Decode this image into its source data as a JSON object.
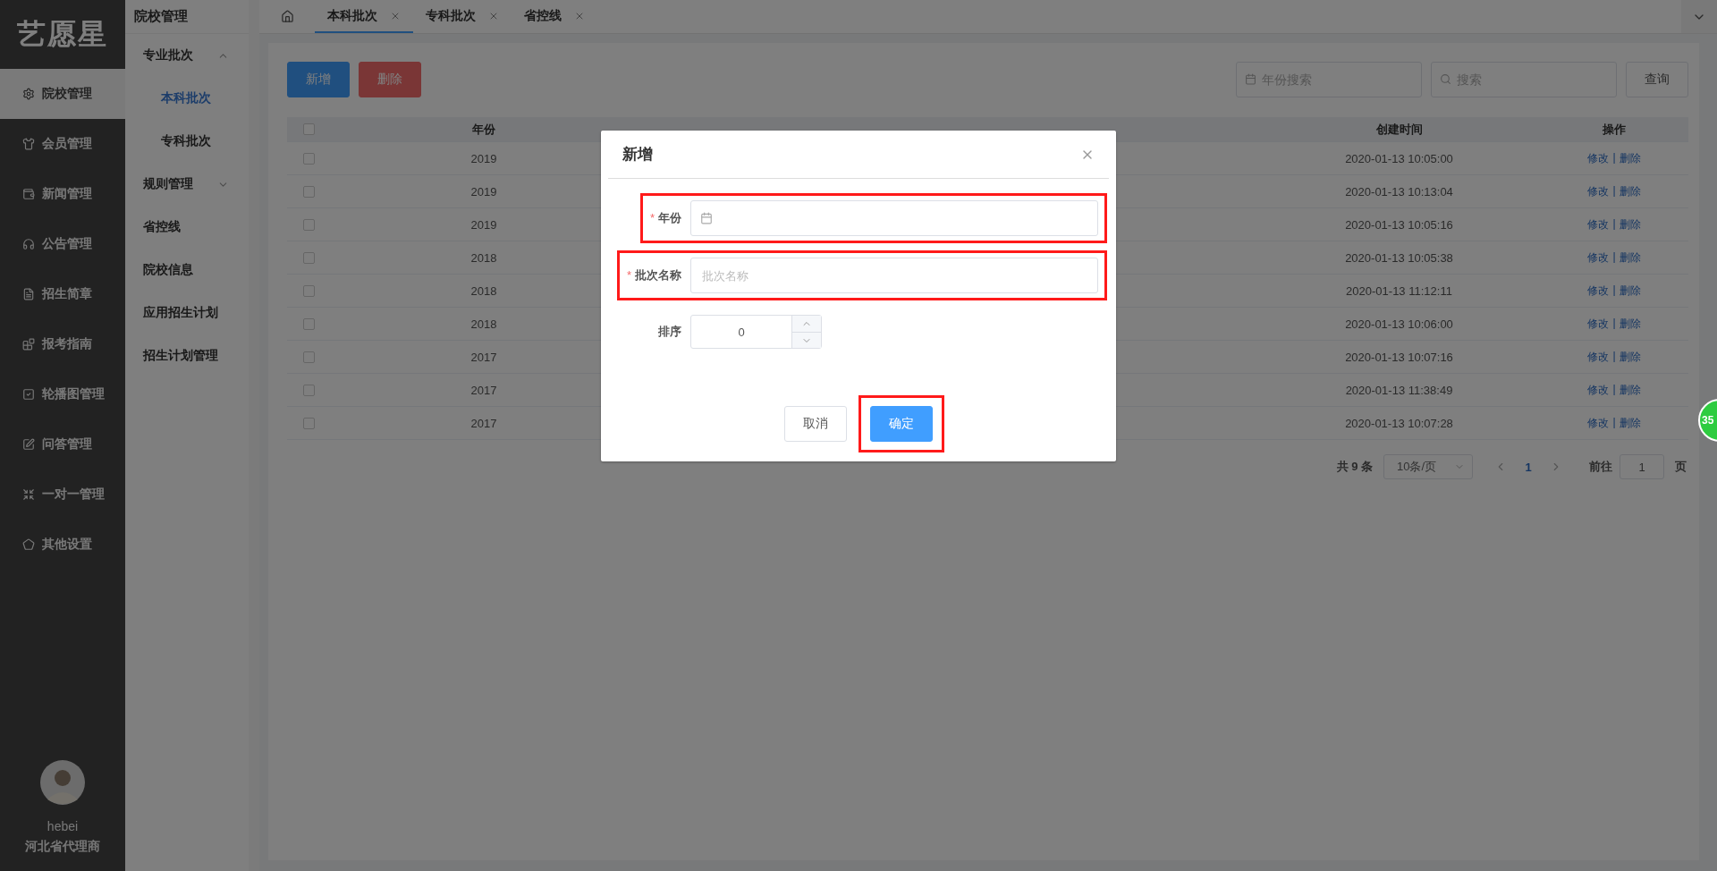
{
  "logo": "艺愿星",
  "nav": [
    {
      "label": "院校管理",
      "selected": true
    },
    {
      "label": "会员管理",
      "selected": false
    },
    {
      "label": "新闻管理",
      "selected": false
    },
    {
      "label": "公告管理",
      "selected": false
    },
    {
      "label": "招生简章",
      "selected": false
    },
    {
      "label": "报考指南",
      "selected": false
    },
    {
      "label": "轮播图管理",
      "selected": false
    },
    {
      "label": "问答管理",
      "selected": false
    },
    {
      "label": "一对一管理",
      "selected": false
    },
    {
      "label": "其他设置",
      "selected": false
    }
  ],
  "user": {
    "name": "hebei",
    "role": "河北省代理商"
  },
  "subnav": {
    "title": "院校管理",
    "items": [
      {
        "label": "专业批次",
        "kind": "group",
        "expanded": true,
        "selected": false,
        "children": [
          {
            "label": "本科批次",
            "selected": true
          },
          {
            "label": "专科批次",
            "selected": false
          }
        ]
      },
      {
        "label": "规则管理",
        "kind": "group",
        "expanded": false,
        "selected": false
      },
      {
        "label": "省控线",
        "kind": "link",
        "selected": false
      },
      {
        "label": "院校信息",
        "kind": "link",
        "selected": false
      },
      {
        "label": "应用招生计划",
        "kind": "link",
        "selected": false
      },
      {
        "label": "招生计划管理",
        "kind": "link",
        "selected": false
      }
    ]
  },
  "tabs": [
    {
      "label": "本科批次",
      "selected": true
    },
    {
      "label": "专科批次",
      "selected": false
    },
    {
      "label": "省控线",
      "selected": false
    }
  ],
  "toolbar": {
    "buttons": [
      {
        "label": "新增",
        "kind": "primary"
      },
      {
        "label": "删除",
        "kind": "danger"
      }
    ],
    "year_search": {
      "placeholder": "年份搜索"
    },
    "search": {
      "placeholder": "搜索"
    },
    "query_button": "查询"
  },
  "table": {
    "all_checked": false,
    "columns": [
      "年份",
      "创建时间",
      "操作"
    ],
    "action_separator": "|",
    "rows": [
      {
        "checked": false,
        "year": "2019",
        "created": "2020-01-13 10:05:00",
        "actions": [
          "修改",
          "删除"
        ]
      },
      {
        "checked": false,
        "year": "2019",
        "created": "2020-01-13 10:13:04",
        "actions": [
          "修改",
          "删除"
        ]
      },
      {
        "checked": false,
        "year": "2019",
        "created": "2020-01-13 10:05:16",
        "actions": [
          "修改",
          "删除"
        ]
      },
      {
        "checked": false,
        "year": "2018",
        "created": "2020-01-13 10:05:38",
        "actions": [
          "修改",
          "删除"
        ]
      },
      {
        "checked": false,
        "year": "2018",
        "created": "2020-01-13 11:12:11",
        "actions": [
          "修改",
          "删除"
        ]
      },
      {
        "checked": false,
        "year": "2018",
        "created": "2020-01-13 10:06:00",
        "actions": [
          "修改",
          "删除"
        ]
      },
      {
        "checked": false,
        "year": "2017",
        "created": "2020-01-13 10:07:16",
        "actions": [
          "修改",
          "删除"
        ]
      },
      {
        "checked": false,
        "year": "2017",
        "created": "2020-01-13 11:38:49",
        "actions": [
          "修改",
          "删除"
        ]
      },
      {
        "checked": false,
        "year": "2017",
        "created": "2020-01-13 10:07:28",
        "actions": [
          "修改",
          "删除"
        ]
      }
    ]
  },
  "pagination": {
    "total": "共 9 条",
    "page_size": "10条/页",
    "pages": [
      {
        "label": "1",
        "selected": true
      }
    ],
    "goto_label": "前往",
    "goto_value": "1",
    "page_suffix": "页"
  },
  "dialog": {
    "title": "新增",
    "fields": [
      {
        "kind": "date",
        "label": "年份",
        "required_mark": "*",
        "highlighted": true
      },
      {
        "kind": "text",
        "label": "批次名称",
        "placeholder": "批次名称",
        "required_mark": "*",
        "highlighted": true
      },
      {
        "kind": "number",
        "label": "排序",
        "value": "0",
        "highlighted": false
      }
    ],
    "buttons": [
      {
        "label": "取消",
        "kind": "default",
        "highlighted": false
      },
      {
        "label": "确定",
        "kind": "primary",
        "highlighted": true
      }
    ]
  },
  "float_badge": "35"
}
